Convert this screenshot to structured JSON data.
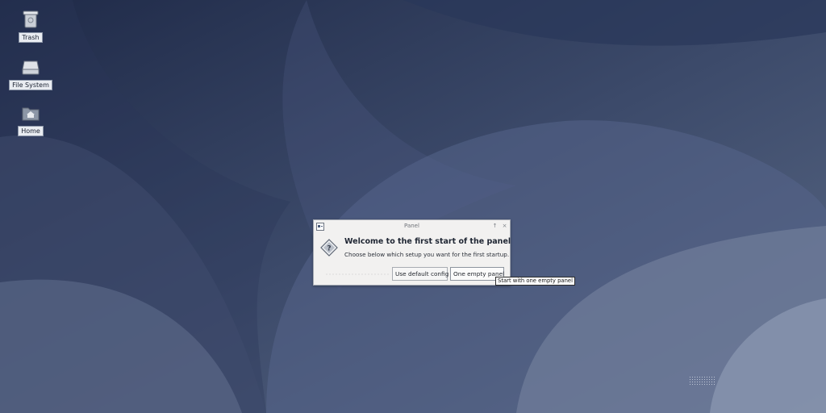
{
  "desktop": {
    "colors": {
      "bg_dark": "#1f2a48",
      "bg_mid": "#4a5878",
      "bg_light": "#8a97af"
    },
    "icons": [
      {
        "label": "Trash",
        "icon": "trash-icon"
      },
      {
        "label": "File System",
        "icon": "drive-icon"
      },
      {
        "label": "Home",
        "icon": "home-folder-icon"
      }
    ]
  },
  "dialog": {
    "title": "Panel",
    "window_icon": "panel-window-icon",
    "maximize_glyph": "↑",
    "close_glyph": "×",
    "heading": "Welcome to the first start of the panel",
    "subtitle": "Choose below which setup you want for the first startup.",
    "buttons": {
      "default_config": "Use default config",
      "empty_panel": "One empty panel"
    },
    "icon": "question-diamond-icon"
  },
  "tooltip": {
    "text": "Start with one empty panel"
  }
}
